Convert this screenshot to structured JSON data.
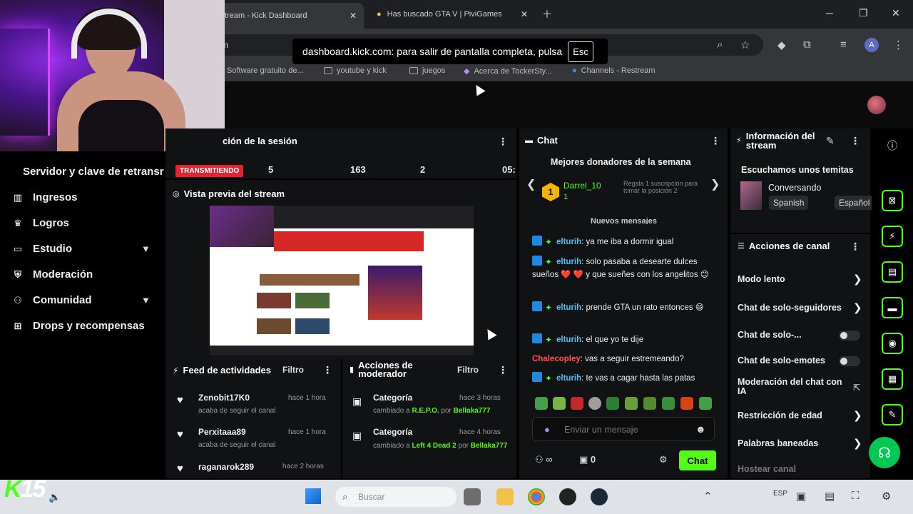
{
  "browser": {
    "tabs": [
      {
        "label": "tream - Kick Dashboard",
        "active": true
      },
      {
        "label": "Has buscado GTA V | PiviGames",
        "active": false
      }
    ],
    "url_fragment": "m",
    "bookmarks": [
      "Software gratuito de...",
      "youtube y kick",
      "juegos",
      "Acerca de TockerSty...",
      "Channels - Restream"
    ],
    "profile_initial": "A"
  },
  "fullscreen_notice": {
    "text": "dashboard.kick.com: para salir de pantalla completa, pulsa",
    "key": "Esc"
  },
  "leftnav": {
    "server_key": "Servidor y clave de retransr",
    "items": [
      {
        "label": "Ingresos",
        "icon": "chart-icon",
        "has_chevron": false
      },
      {
        "label": "Logros",
        "icon": "trophy-icon",
        "has_chevron": false
      },
      {
        "label": "Estudio",
        "icon": "video-icon",
        "has_chevron": true
      },
      {
        "label": "Moderación",
        "icon": "shield-icon",
        "has_chevron": false
      },
      {
        "label": "Comunidad",
        "icon": "users-icon",
        "has_chevron": true
      },
      {
        "label": "Drops y recompensas",
        "icon": "gift-icon",
        "has_chevron": false
      }
    ]
  },
  "session": {
    "title": "ción de la sesión",
    "live_label": "TRANSMITIENDO",
    "stats": [
      "5",
      "163",
      "2",
      "05:"
    ]
  },
  "preview": {
    "title": "Vista previa del stream"
  },
  "feed": {
    "title": "Feed de actividades",
    "filter": "Filtro",
    "items": [
      {
        "name": "Zenobit17K0",
        "sub": "acaba de seguir el canal",
        "time": "hace 1 hora"
      },
      {
        "name": "Perxitaaa89",
        "sub": "acaba de seguir el canal",
        "time": "hace 1 hora"
      },
      {
        "name": "raganarok289",
        "sub": "",
        "time": "hace 2 horas"
      }
    ]
  },
  "modactions": {
    "title": "Acciones de moderador",
    "filter": "Filtro",
    "items": [
      {
        "name": "Categoría",
        "sub_prefix": "cambiado a",
        "game": "R.E.P.O.",
        "by_prefix": "por",
        "by": "Bellaka777",
        "time": "hace 3 horas"
      },
      {
        "name": "Categoría",
        "sub_prefix": "cambiado a",
        "game": "Left 4 Dead 2",
        "by_prefix": "por",
        "by": "Bellaka777",
        "time": "hace 4 horas"
      }
    ]
  },
  "chat": {
    "title": "Chat",
    "donors_title": "Mejores donadores de la semana",
    "donor_rank": "1",
    "donor_name": "Darrel_10",
    "donor_count": "1",
    "donor_hint": "Regala 1 suscripción para tomar la posición 2",
    "new_messages": "Nuevos mensajes",
    "messages": [
      {
        "user": "elturih",
        "text": ": ya me iba a dormir igual"
      },
      {
        "user": "elturih",
        "text": ": solo pasaba a desearte dulces sueños ❤️ ❤️ y que sueñes con los angelitos 😊"
      },
      {
        "user": "elturih",
        "text": ": prende GTA un rato entonces 😄"
      },
      {
        "user": "elturih",
        "text": ": el que yo te dije"
      },
      {
        "user": "Chalecopley",
        "text": ": vas a seguir estremeando?"
      },
      {
        "user": "elturih",
        "text": ": te vas a cagar hasta las patas"
      }
    ],
    "input_placeholder": "Enviar un mensaje",
    "viewers": "∞",
    "count": "0",
    "send_label": "Chat"
  },
  "streaminfo": {
    "title": "Información del stream",
    "stream_title": "Escuchamos unos temitas",
    "category": "Conversando",
    "tags": [
      "Spanish",
      "Español"
    ]
  },
  "channelactions": {
    "title": "Acciones de canal",
    "items": [
      {
        "label": "Modo lento",
        "control": "chevron"
      },
      {
        "label": "Chat de solo-seguidores",
        "control": "chevron"
      },
      {
        "label": "Chat de solo-...",
        "control": "toggle"
      },
      {
        "label": "Chat de solo-emotes",
        "control": "toggle"
      },
      {
        "label": "Moderación del chat con IA",
        "control": "external"
      },
      {
        "label": "Restricción de edad",
        "control": "chevron"
      },
      {
        "label": "Palabras baneadas",
        "control": "chevron"
      },
      {
        "label": "Hostear canal",
        "control": "none"
      }
    ]
  },
  "taskbar": {
    "search_placeholder": "Buscar",
    "lang": "ESP",
    "overlay_text": "15"
  },
  "colors": {
    "kick_green": "#53fc18",
    "live_red": "#e0262f",
    "panel_bg": "#111214",
    "chat_user": "#4fc3f7"
  }
}
